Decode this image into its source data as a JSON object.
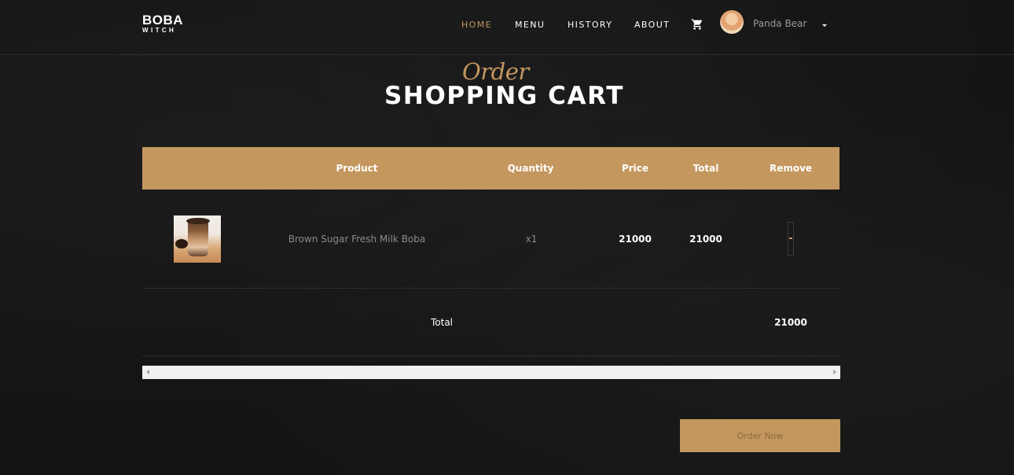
{
  "brand": {
    "top": "BOBA",
    "bottom": "WITCH"
  },
  "nav": {
    "items": [
      {
        "label": "HOME",
        "active": true
      },
      {
        "label": "MENU",
        "active": false
      },
      {
        "label": "HISTORY",
        "active": false
      },
      {
        "label": "ABOUT",
        "active": false
      }
    ],
    "cart_icon": "shopping-cart-icon",
    "user_name": "Panda Bear",
    "caret_icon": "caret-down-icon"
  },
  "heading": {
    "script": "Order",
    "title": "SHOPPING CART"
  },
  "table": {
    "columns": [
      "Product",
      "Quantity",
      "Price",
      "Total",
      "Remove"
    ],
    "rows": [
      {
        "product": "Brown Sugar Fresh Milk Boba",
        "quantity": "x1",
        "price": "21000",
        "total": "21000"
      }
    ],
    "footer": {
      "label": "Total",
      "value": "21000"
    }
  },
  "order_button": "Order Now",
  "colors": {
    "accent": "#c4975f",
    "background": "#141414"
  }
}
